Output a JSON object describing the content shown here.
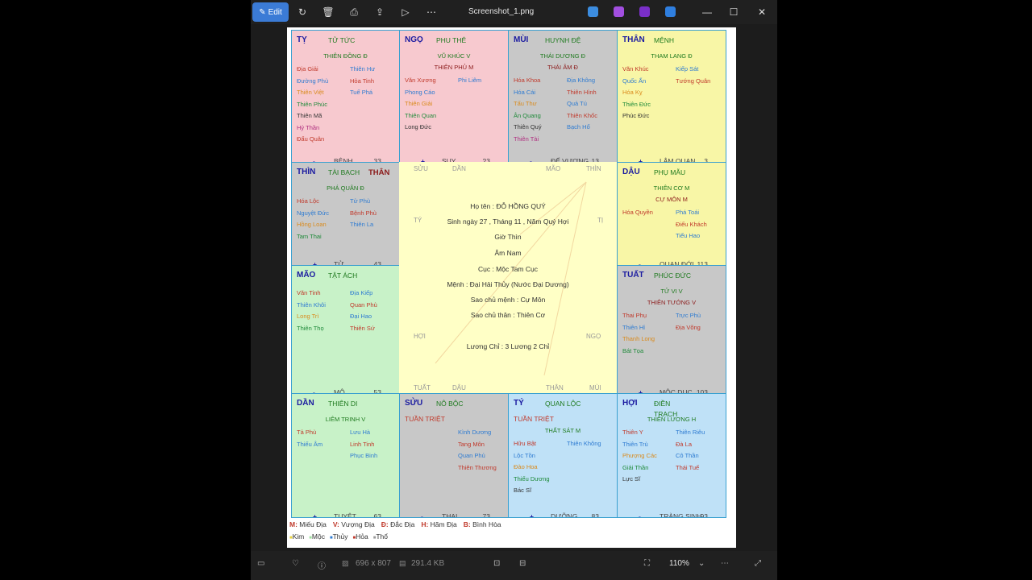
{
  "window": {
    "edit_label": "Edit",
    "title": "Screenshot_1.png",
    "zoom": "110%",
    "dimensions": "696 x 807",
    "filesize": "291.4 KB"
  },
  "chart": {
    "cells": [
      {
        "name": "TỴ",
        "palace": "TỬ TỨC",
        "main": "THIÊN ĐỒNG Đ",
        "left": [
          "Địa Giải",
          "Đường Phù",
          "Thiên Việt",
          "Thiên Phúc",
          "Thiên Mã",
          "Hỷ Thần",
          "Đẩu Quân"
        ],
        "right": [
          "Thiên Hư",
          "Hỏa Tinh",
          "Tuế Phá"
        ],
        "plus": "-",
        "phase": "BỆNH",
        "age": "33"
      },
      {
        "name": "NGỌ",
        "palace": "PHU THÊ",
        "main": "VŨ KHÚC V",
        "main2": "THIÊN PHỦ M",
        "left": [
          "Văn Xương",
          "Phong Cáo",
          "Thiên Giải",
          "Thiên Quan",
          "Long Đức"
        ],
        "right": [
          "Phi Liêm"
        ],
        "plus": "+",
        "phase": "SUY",
        "age": "23"
      },
      {
        "name": "MÙI",
        "palace": "HUYNH ĐỆ",
        "main": "THÁI DƯƠNG Đ",
        "main2": "THÁI ÂM Đ",
        "left": [
          "Hóa Khoa",
          "Hóa Cái",
          "Tấu Thư",
          "Ân Quang",
          "Thiên Quý",
          "Thiên Tài"
        ],
        "right": [
          "Địa Không",
          "Thiên Hình",
          "Quả Tú",
          "Thiên Khốc",
          "Bạch Hổ"
        ],
        "plus": "-",
        "phase": "ĐẾ VƯỢNG",
        "age": "13"
      },
      {
        "name": "THÂN",
        "palace": "MỆNH",
        "main": "THAM LANG Đ",
        "left": [
          "Văn Khúc",
          "Quốc Ấn",
          "Hóa Kỵ",
          "Thiên Đức",
          "Phúc Đức"
        ],
        "right": [
          "Kiếp Sát",
          "Tướng Quân"
        ],
        "plus": "+",
        "phase": "LÂM QUAN",
        "age": "3"
      },
      {
        "name": "THÌN",
        "palace": "TÀI BẠCH",
        "tag": "THÂN",
        "main": "PHÁ QUÂN Đ",
        "left": [
          "Hóa Lộc",
          "Nguyệt Đức",
          "Hồng Loan",
          "Tam Thai"
        ],
        "right": [
          "Tử Phù",
          "Bệnh Phù",
          "Thiên La"
        ],
        "plus": "+",
        "phase": "TỬ",
        "age": "43"
      },
      {
        "name": "DẬU",
        "palace": "PHỤ MẪU",
        "main": "THIÊN CƠ M",
        "main2": "CỰ MÔN M",
        "left": [
          "Hóa Quyền"
        ],
        "right": [
          "Phá Toái",
          "Điếu Khách",
          "Tiểu Hao"
        ],
        "plus": "-",
        "phase": "QUAN ĐỚI",
        "age": "113"
      },
      {
        "name": "MÃO",
        "palace": "TẬT ÁCH",
        "left": [
          "Văn Tinh",
          "Thiên Khôi",
          "Long Trì",
          "Thiên Thọ"
        ],
        "right": [
          "Địa Kiếp",
          "Quan Phù",
          "Đại Hao",
          "Thiên Sứ"
        ],
        "plus": "-",
        "phase": "MỘ",
        "age": "53"
      },
      {
        "name": "TUẤT",
        "palace": "PHÚC ĐỨC",
        "main": "TỬ VI V",
        "main2": "THIÊN TƯỚNG V",
        "left": [
          "Thai Phụ",
          "Thiên Hỉ",
          "Thanh Long",
          "Bát Tọa"
        ],
        "right": [
          "Trực Phù",
          "Địa Võng"
        ],
        "plus": "+",
        "phase": "MỘC DỤC",
        "age": "103"
      },
      {
        "name": "DẦN",
        "palace": "THIÊN DI",
        "main": "LIÊM TRINH V",
        "left": [
          "Tả Phù",
          "Thiếu Âm"
        ],
        "right": [
          "Lưu Hà",
          "Linh Tinh",
          "Phục Binh"
        ],
        "plus": "+",
        "phase": "TUYỆT",
        "age": "63"
      },
      {
        "name": "SỬU",
        "palace": "NÔ BỘC",
        "tag": "TUẦN TRIỆT",
        "left": [],
        "right": [
          "Kình Dương",
          "Tang Môn",
          "Quan Phủ",
          "Thiên Thương"
        ],
        "plus": "-",
        "phase": "THAI",
        "age": "73"
      },
      {
        "name": "TÝ",
        "palace": "QUAN LỘC",
        "tag": "TUẦN TRIỆT",
        "main": "THẤT SÁT M",
        "left": [
          "Hữu Bật",
          "Lộc Tồn",
          "Đào Hoa",
          "Thiếu Dương",
          "Bác Sĩ"
        ],
        "right": [
          "Thiên Không"
        ],
        "plus": "+",
        "phase": "DƯỠNG",
        "age": "83"
      },
      {
        "name": "HỢI",
        "palace": "ĐIỀN",
        "palace2": "TRẠCH",
        "main": "THIÊN LƯƠNG H",
        "left": [
          "Thiên Y",
          "Thiên Trù",
          "Phượng Các",
          "Giải Thần",
          "Lực Sĩ"
        ],
        "right": [
          "Thiên Riêu",
          "Đà La",
          "Cô Thần",
          "Thái Tuế"
        ],
        "plus": "-",
        "phase": "TRÀNG SINH",
        "age": "93"
      }
    ],
    "center": {
      "lines": [
        "Họ tên : ĐỖ HỒNG QUÝ",
        "Sinh ngày 27 , Tháng 11 , Năm Quý Hợi",
        "Giờ Thìn",
        "Âm Nam",
        "Cục : Mộc Tam Cục",
        "Mệnh : Đại Hải Thủy (Nước Đại Dương)",
        "Sao chủ mệnh : Cự Môn",
        "Sao chủ thân : Thiên Cơ",
        "Lương Chỉ : 3 Lương 2 Chỉ"
      ],
      "corners": [
        "SỬU",
        "DẦN",
        "MÃO",
        "THÌN",
        "TÝ",
        "TỊ",
        "HỢI",
        "NGỌ",
        "TUẤT",
        "DẬU",
        "THÂN",
        "MÙI"
      ]
    },
    "legend": {
      "row1": [
        [
          "M",
          "Miếu Địa"
        ],
        [
          "V",
          "Vượng Địa"
        ],
        [
          "Đ",
          "Đắc Địa"
        ],
        [
          "H",
          "Hãm Địa"
        ],
        [
          "B",
          "Bình Hòa"
        ]
      ],
      "row2": [
        "Kim",
        "Mộc",
        "Thủy",
        "Hỏa",
        "Thổ"
      ]
    },
    "colors": {
      "ty": "#f7c9cf",
      "ngo": "#f7c9cf",
      "mui": "#c8c8c8",
      "than": "#f8f6a6",
      "thin": "#c8c8c8",
      "dau": "#f8f6a6",
      "mao": "#c8f2c8",
      "tuat": "#c8c8c8",
      "dan": "#c8f2c8",
      "suu": "#c8c8c8",
      "tyy": "#bfe1f7",
      "hoi": "#bfe1f7"
    }
  }
}
